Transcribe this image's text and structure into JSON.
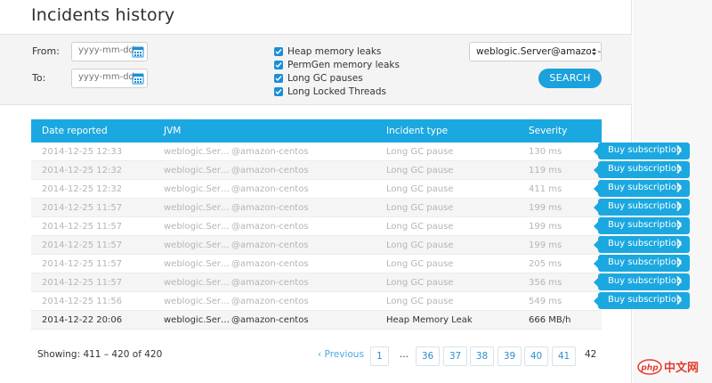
{
  "page": {
    "title": "Incidents history"
  },
  "filters": {
    "from_label": "From:",
    "to_label": "To:",
    "date_placeholder": "yyyy-mm-dd",
    "checkboxes": [
      {
        "label": "Heap memory leaks",
        "checked": true
      },
      {
        "label": "PermGen memory leaks",
        "checked": true
      },
      {
        "label": "Long GC pauses",
        "checked": true
      },
      {
        "label": "Long Locked Threads",
        "checked": true
      }
    ],
    "jvm_selected": "weblogic.Server@amazon-centos",
    "search_label": "SEARCH"
  },
  "table": {
    "headers": [
      "Date reported",
      "JVM",
      "Incident type",
      "Severity"
    ],
    "rows": [
      {
        "date": "2014-12-25 12:33",
        "jvm_a": "weblogic.Ser…",
        "jvm_b": "@amazon-centos",
        "type": "Long GC pause",
        "severity": "130 ms"
      },
      {
        "date": "2014-12-25 12:32",
        "jvm_a": "weblogic.Ser…",
        "jvm_b": "@amazon-centos",
        "type": "Long GC pause",
        "severity": "119 ms"
      },
      {
        "date": "2014-12-25 12:32",
        "jvm_a": "weblogic.Ser…",
        "jvm_b": "@amazon-centos",
        "type": "Long GC pause",
        "severity": "411 ms"
      },
      {
        "date": "2014-12-25 11:57",
        "jvm_a": "weblogic.Ser…",
        "jvm_b": "@amazon-centos",
        "type": "Long GC pause",
        "severity": "199 ms"
      },
      {
        "date": "2014-12-25 11:57",
        "jvm_a": "weblogic.Ser…",
        "jvm_b": "@amazon-centos",
        "type": "Long GC pause",
        "severity": "199 ms"
      },
      {
        "date": "2014-12-25 11:57",
        "jvm_a": "weblogic.Ser…",
        "jvm_b": "@amazon-centos",
        "type": "Long GC pause",
        "severity": "199 ms"
      },
      {
        "date": "2014-12-25 11:57",
        "jvm_a": "weblogic.Ser…",
        "jvm_b": "@amazon-centos",
        "type": "Long GC pause",
        "severity": "205 ms"
      },
      {
        "date": "2014-12-25 11:57",
        "jvm_a": "weblogic.Ser…",
        "jvm_b": "@amazon-centos",
        "type": "Long GC pause",
        "severity": "356 ms"
      },
      {
        "date": "2014-12-25 11:56",
        "jvm_a": "weblogic.Ser…",
        "jvm_b": "@amazon-centos",
        "type": "Long GC pause",
        "severity": "549 ms"
      },
      {
        "date": "2014-12-22 20:06",
        "jvm_a": "weblogic.Ser…",
        "jvm_b": "@amazon-centos",
        "type": "Heap Memory Leak",
        "severity": "666 MB/h"
      }
    ],
    "buy_label": "Buy subscription"
  },
  "footer": {
    "showing": "Showing: 411 – 420 of 420",
    "previous": "Previous",
    "ellipsis": "...",
    "pages": [
      "1",
      "36",
      "37",
      "38",
      "39",
      "40",
      "41"
    ],
    "current_page": "42"
  },
  "watermark": {
    "text": "php中文网",
    "color": "#e23a2e"
  },
  "colors": {
    "accent": "#1ba8e0",
    "link": "#2e8fcf"
  }
}
